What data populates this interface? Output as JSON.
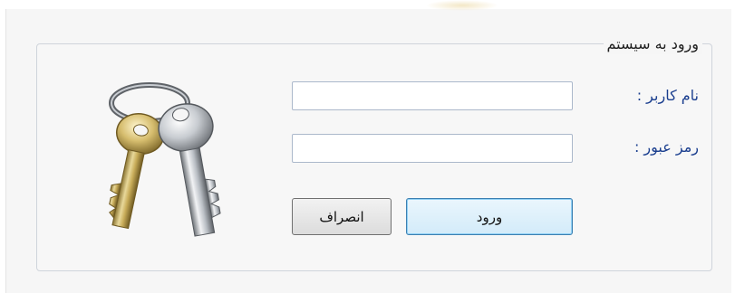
{
  "login": {
    "group_title": "ورود به سیستم",
    "username_label": "نام کاربر :",
    "password_label": "رمز عبور :",
    "username_value": "",
    "password_value": "",
    "login_button": "ورود",
    "cancel_button": "انصراف",
    "icon": "keys-icon"
  },
  "colors": {
    "label_text": "#1b3f8f",
    "login_button_border": "#3c7fb1",
    "group_border": "#cfd4db"
  }
}
